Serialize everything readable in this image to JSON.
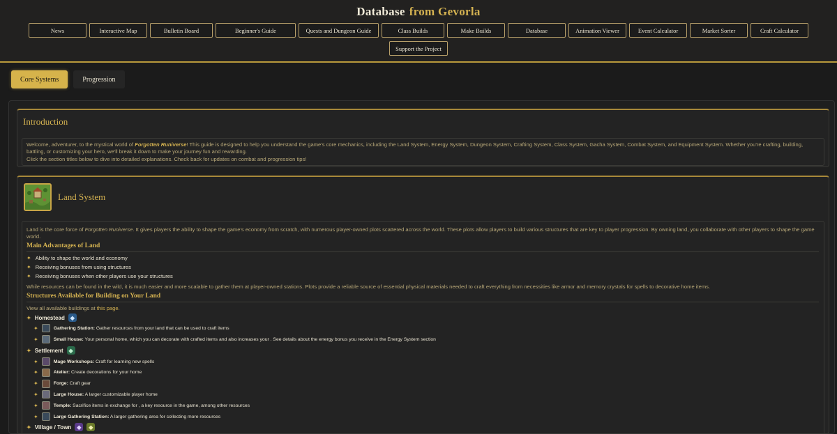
{
  "site": {
    "title": "Database",
    "title_accent": "from Gevorla"
  },
  "nav": {
    "row1": [
      {
        "label": "News",
        "w": 83
      },
      {
        "label": "Interactive Map",
        "w": 83
      },
      {
        "label": "Bulletin Board",
        "w": 90
      },
      {
        "label": "Beginner's Guide",
        "w": 115
      },
      {
        "label": "Quests and Dungeon Guide",
        "w": 115
      },
      {
        "label": "Class Builds",
        "w": 90
      },
      {
        "label": "Make Builds",
        "w": 83
      },
      {
        "label": "Database",
        "w": 83
      },
      {
        "label": "Animation Viewer",
        "w": 83
      },
      {
        "label": "Event Calculator",
        "w": 83
      },
      {
        "label": "Market Sorter",
        "w": 83
      },
      {
        "label": "Craft Calculator",
        "w": 83
      }
    ],
    "row2": [
      {
        "label": "Support the Project",
        "w": 84
      }
    ]
  },
  "tabs": [
    {
      "label": "Core Systems",
      "active": true
    },
    {
      "label": "Progression",
      "active": false
    }
  ],
  "intro": {
    "title": "Introduction",
    "p1_a": "Welcome, adventurer, to the mystical world of ",
    "p1_game": "Forgotten Runiverse",
    "p1_b": "! This guide is designed to help you understand the game's core mechanics, including the Land System, Energy System, Dungeon System, Crafting System, Class System, Gacha System, Combat System, and Equipment System. Whether you're crafting, building, battling, or customizing your hero, we'll break it down to make your journey fun and rewarding.",
    "p2": "Click the section titles below to dive into detailed explanations. Check back for updates on combat and progression tips!"
  },
  "land": {
    "title": "Land System",
    "p1_a": "Land is the core force of ",
    "p1_game": "Forgotten Runiverse",
    "p1_b": ". It gives players the ability to shape the game's economy from scratch, with numerous player-owned plots scattered across the world. These plots allow players to build various structures that are key to player progression. By owning land, you collaborate with other players to shape the game world.",
    "advantages_title": "Main Advantages of Land",
    "advantages": [
      "Ability to shape the world and economy",
      "Receiving bonuses from using structures",
      "Receiving bonuses when other players use your structures"
    ],
    "resources_text": "While resources can be found in the wild, it is much easier and more scalable to gather them at player-owned stations. Plots provide a reliable source of essential physical materials needed to craft everything from necessities like armor and memory crystals for spells to decorative home items.",
    "structures_title": "Structures Available for Building on Your Land",
    "view_a": "View all available buildings at ",
    "view_link": "this page.",
    "homestead": {
      "label": "Homestead",
      "items": [
        {
          "name": "Gathering Station:",
          "desc": "Gather resources from your land that can be used to craft items",
          "color": "#3a4a5a"
        },
        {
          "name": "Small House:",
          "desc": "Your personal home, which you can decorate with crafted items and also increases your . See details about the energy bonus you receive in the Energy System section",
          "color": "#5a6a7a"
        }
      ]
    },
    "settlement": {
      "label": "Settlement",
      "items": [
        {
          "name": "Mage Workshops:",
          "desc": "Craft for learning new spells",
          "color": "#5a4a6a"
        },
        {
          "name": "Atelier:",
          "desc": "Create decorations for your home",
          "color": "#8a6a4a"
        },
        {
          "name": "Forge:",
          "desc": "Craft gear",
          "color": "#6a4a3a"
        },
        {
          "name": "Large House:",
          "desc": "A larger customizable player home",
          "color": "#6a6a7a"
        },
        {
          "name": "Temple:",
          "desc": "Sacrifice items in exchange for , a key resource in the game, among other resources",
          "color": "#7a5a5a"
        },
        {
          "name": "Large Gathering Station:",
          "desc": "A larger gathering area for collecting more resources",
          "color": "#3a4a5a"
        }
      ]
    },
    "village": {
      "label": "Village / Town"
    }
  },
  "colors": {
    "accent": "#d4b251",
    "background": "#1b1b1b"
  }
}
